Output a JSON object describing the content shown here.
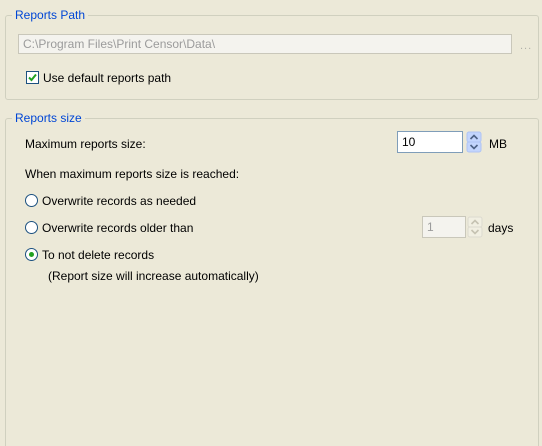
{
  "reports_path": {
    "legend": "Reports Path",
    "path_value": "C:\\Program Files\\Print Censor\\Data\\",
    "browse_label": "...",
    "use_default_label": "Use default reports path",
    "use_default_checked": true
  },
  "reports_size": {
    "legend": "Reports size",
    "max_size_label": "Maximum reports size:",
    "max_size_value": "10",
    "max_size_unit": "MB",
    "when_reached_label": "When maximum reports size is reached:",
    "options": [
      {
        "label": "Overwrite records as needed",
        "selected": false
      },
      {
        "label": "Overwrite records older than",
        "selected": false
      },
      {
        "label": "To not delete records",
        "selected": true
      }
    ],
    "older_than_value": "1",
    "older_than_unit": "days",
    "note": "(Report size will increase automatically)"
  },
  "colors": {
    "legend_text": "#0046d5",
    "background": "#ece9d8",
    "check_mark": "#21a121"
  },
  "icons": {
    "checkbox_checked": "check-mark-icon",
    "spin_up": "spin-up-arrow-icon",
    "spin_down": "spin-down-arrow-icon"
  }
}
